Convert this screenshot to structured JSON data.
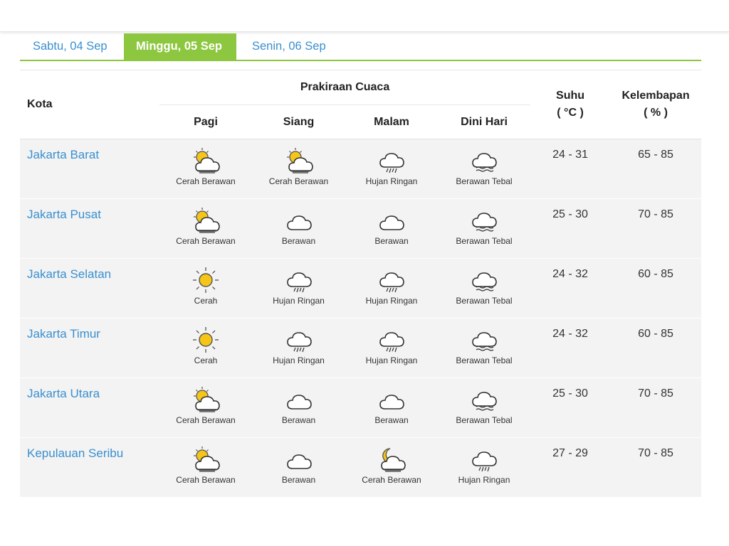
{
  "tabs": [
    {
      "label": "Sabtu, 04 Sep",
      "active": false
    },
    {
      "label": "Minggu, 05 Sep",
      "active": true
    },
    {
      "label": "Senin, 06 Sep",
      "active": false
    }
  ],
  "header": {
    "kota": "Kota",
    "prakiraan": "Prakiraan Cuaca",
    "pagi": "Pagi",
    "siang": "Siang",
    "malam": "Malam",
    "dini_hari": "Dini Hari",
    "suhu": "Suhu",
    "suhu_unit": "( °C )",
    "kelembapan": "Kelembapan",
    "kelembapan_unit": "( % )"
  },
  "rows": [
    {
      "city": "Jakarta Barat",
      "forecast": [
        {
          "label": "Cerah Berawan",
          "icon": "partly-cloudy-icon"
        },
        {
          "label": "Cerah Berawan",
          "icon": "partly-cloudy-icon"
        },
        {
          "label": "Hujan Ringan",
          "icon": "light-rain-icon"
        },
        {
          "label": "Berawan Tebal",
          "icon": "overcast-icon"
        }
      ],
      "suhu": "24 - 31",
      "kelembapan": "65 - 85"
    },
    {
      "city": "Jakarta Pusat",
      "forecast": [
        {
          "label": "Cerah Berawan",
          "icon": "partly-cloudy-icon"
        },
        {
          "label": "Berawan",
          "icon": "cloudy-icon"
        },
        {
          "label": "Berawan",
          "icon": "cloudy-icon"
        },
        {
          "label": "Berawan Tebal",
          "icon": "overcast-icon"
        }
      ],
      "suhu": "25 - 30",
      "kelembapan": "70 - 85"
    },
    {
      "city": "Jakarta Selatan",
      "forecast": [
        {
          "label": "Cerah",
          "icon": "sunny-icon"
        },
        {
          "label": "Hujan Ringan",
          "icon": "light-rain-icon"
        },
        {
          "label": "Hujan Ringan",
          "icon": "light-rain-icon"
        },
        {
          "label": "Berawan Tebal",
          "icon": "overcast-icon"
        }
      ],
      "suhu": "24 - 32",
      "kelembapan": "60 - 85"
    },
    {
      "city": "Jakarta Timur",
      "forecast": [
        {
          "label": "Cerah",
          "icon": "sunny-icon"
        },
        {
          "label": "Hujan Ringan",
          "icon": "light-rain-icon"
        },
        {
          "label": "Hujan Ringan",
          "icon": "light-rain-icon"
        },
        {
          "label": "Berawan Tebal",
          "icon": "overcast-icon"
        }
      ],
      "suhu": "24 - 32",
      "kelembapan": "60 - 85"
    },
    {
      "city": "Jakarta Utara",
      "forecast": [
        {
          "label": "Cerah Berawan",
          "icon": "partly-cloudy-icon"
        },
        {
          "label": "Berawan",
          "icon": "cloudy-icon"
        },
        {
          "label": "Berawan",
          "icon": "cloudy-icon"
        },
        {
          "label": "Berawan Tebal",
          "icon": "overcast-icon"
        }
      ],
      "suhu": "25 - 30",
      "kelembapan": "70 - 85"
    },
    {
      "city": "Kepulauan Seribu",
      "forecast": [
        {
          "label": "Cerah Berawan",
          "icon": "partly-cloudy-icon"
        },
        {
          "label": "Berawan",
          "icon": "cloudy-icon"
        },
        {
          "label": "Cerah Berawan",
          "icon": "partly-cloudy-night-icon"
        },
        {
          "label": "Hujan Ringan",
          "icon": "light-rain-icon"
        }
      ],
      "suhu": "27 - 29",
      "kelembapan": "70 - 85"
    }
  ],
  "colors": {
    "accent": "#8dc63f",
    "link": "#3a8fcf",
    "row_bg": "#f3f3f3",
    "sun": "#f5c518"
  }
}
